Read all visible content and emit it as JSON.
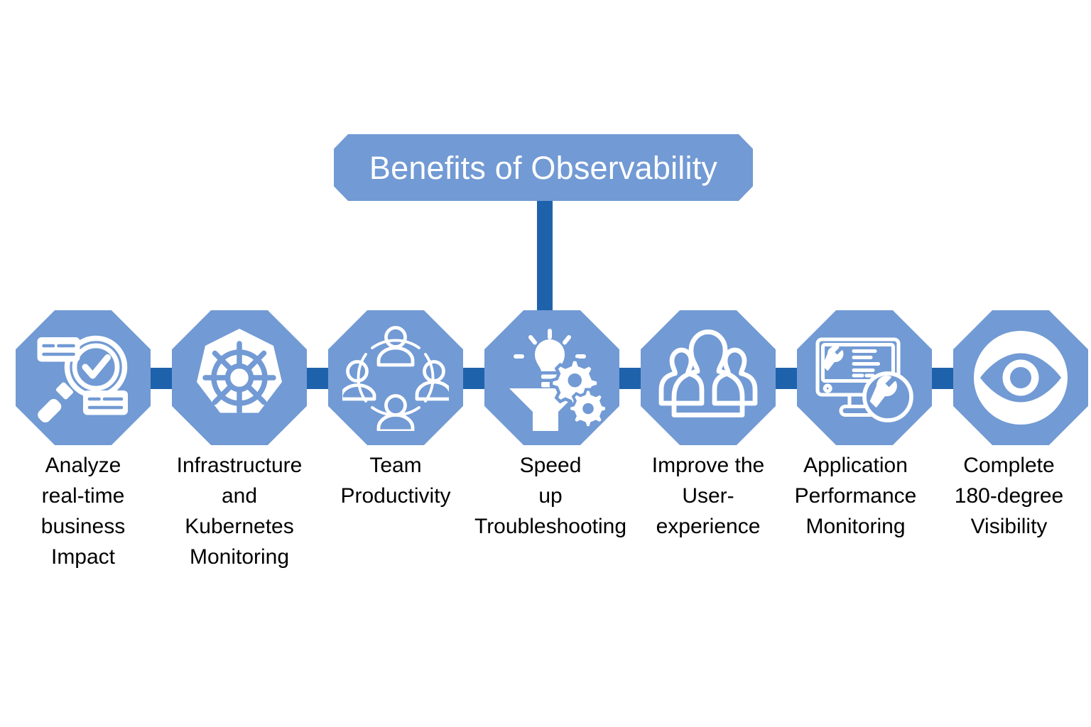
{
  "diagram": {
    "title": "Benefits of Observability",
    "type": "horizontal-node-chain",
    "colors": {
      "node_fill": "#729AD4",
      "connector": "#1F62AC",
      "title_fill": "#729AD4",
      "title_text": "#FFFFFF",
      "label_text": "#000000",
      "background": "#FFFFFF"
    },
    "nodes": [
      {
        "id": "analyze-business-impact",
        "icon": "magnifier-check-icon",
        "label": "Analyze real-time business Impact",
        "label_lines": [
          "Analyze",
          "real-time",
          "business",
          "Impact"
        ]
      },
      {
        "id": "infrastructure-kubernetes",
        "icon": "kubernetes-helm-icon",
        "label": "Infrastructure and Kubernetes Monitoring",
        "label_lines": [
          "Infrastructure",
          "and",
          "Kubernetes",
          "Monitoring"
        ]
      },
      {
        "id": "team-productivity",
        "icon": "people-circle-icon",
        "label": "Team Productivity",
        "label_lines": [
          "Team",
          "Productivity"
        ]
      },
      {
        "id": "speed-up-troubleshooting",
        "icon": "lightbulb-funnel-gears-icon",
        "label": "Speed up Troubleshooting",
        "label_lines": [
          "Speed",
          "up",
          "Troubleshooting"
        ]
      },
      {
        "id": "improve-user-experience",
        "icon": "three-users-icon",
        "label": "Improve the User-experience",
        "label_lines": [
          "Improve the",
          "User-",
          "experience"
        ]
      },
      {
        "id": "application-performance-monitoring",
        "icon": "monitor-wrench-icon",
        "label": "Application Performance Monitoring",
        "label_lines": [
          "Application",
          "Performance",
          "Monitoring"
        ]
      },
      {
        "id": "complete-visibility",
        "icon": "eye-target-icon",
        "label": "Complete 180-degree Visibility",
        "label_lines": [
          "Complete",
          "180-degree",
          "Visibility"
        ]
      }
    ]
  }
}
